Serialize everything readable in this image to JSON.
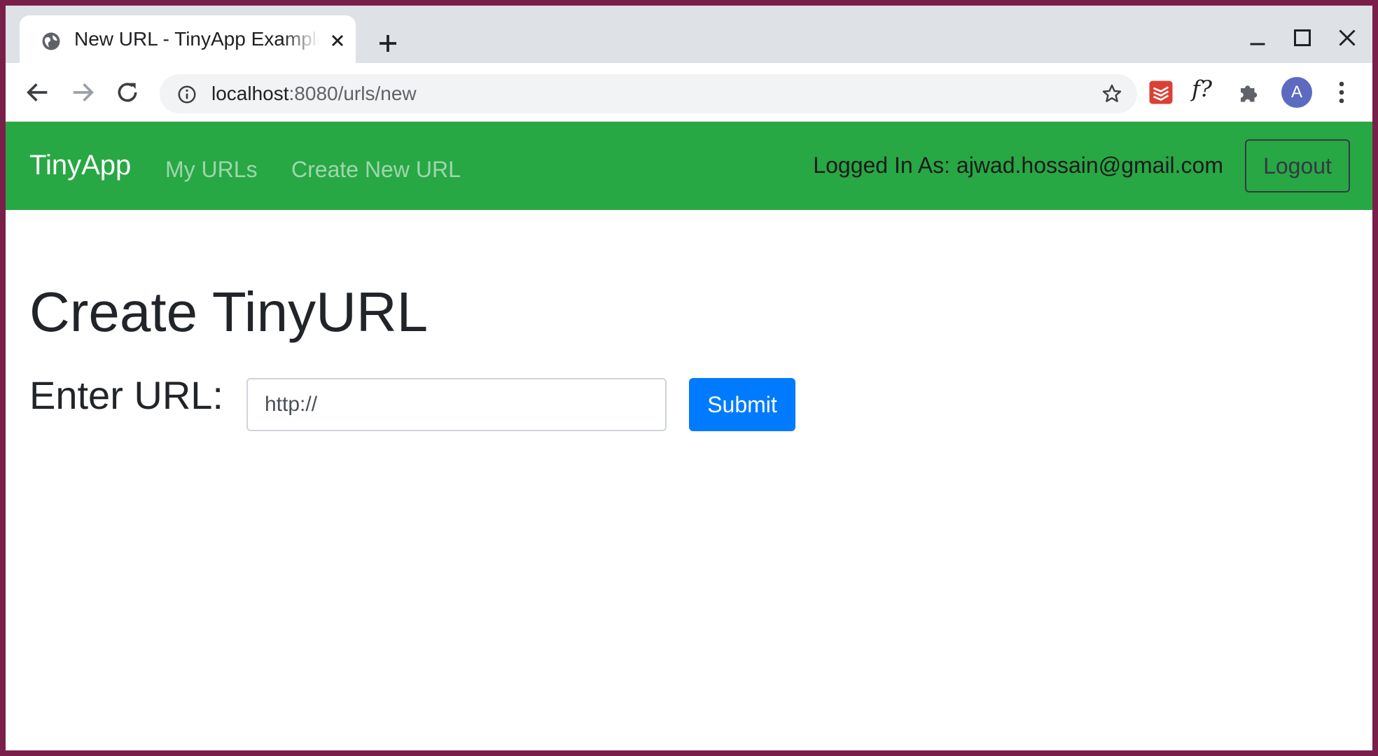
{
  "browser": {
    "tab": {
      "title": "New URL - TinyApp Example",
      "icon": "globe-icon"
    },
    "omnibox": {
      "host": "localhost",
      "path": ":8080/urls/new"
    },
    "extensions": {
      "fx_label": "f?"
    },
    "profile_initial": "A"
  },
  "navbar": {
    "brand": "TinyApp",
    "links": [
      "My URLs",
      "Create New URL"
    ],
    "logged_in_text": "Logged In As: ajwad.hossain@gmail.com",
    "logout_label": "Logout",
    "color": "#28a745"
  },
  "main": {
    "heading": "Create TinyURL",
    "url_label": "Enter URL:",
    "url_value": "http://",
    "submit_label": "Submit",
    "submit_color": "#007bff"
  }
}
